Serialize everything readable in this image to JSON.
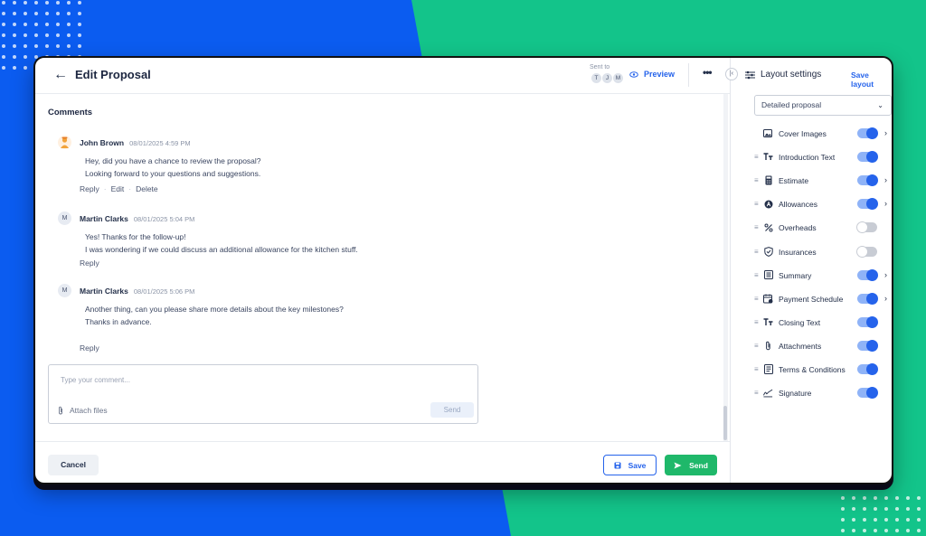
{
  "header": {
    "back_icon": "arrow-left-icon",
    "title": "Edit Proposal",
    "sent_to_label": "Sent to",
    "recipients": [
      "T",
      "J",
      "M"
    ],
    "preview_label": "Preview",
    "more_icon": "more-horizontal-icon"
  },
  "comments": {
    "heading": "Comments",
    "items": [
      {
        "author": "John Brown",
        "time": "08/01/2025 4:59 PM",
        "avatar": "",
        "lines": [
          "Hey, did you have a chance to review the proposal?",
          "Looking forward to your questions and suggestions."
        ],
        "actions": [
          "Reply",
          "Edit",
          "Delete"
        ]
      },
      {
        "author": "Martin Clarks",
        "time": "08/01/2025 5:04 PM",
        "avatar": "M",
        "lines": [
          "Yes! Thanks for the follow-up!",
          "I was wondering if we could discuss an additional allowance for the kitchen stuff."
        ],
        "actions": [
          "Reply"
        ]
      },
      {
        "author": "Martin Clarks",
        "time": "08/01/2025 5:06 PM",
        "avatar": "M",
        "lines": [
          "Another thing, can you please share more details about the key milestones?",
          "Thanks in advance."
        ],
        "actions": [
          "Reply"
        ]
      }
    ]
  },
  "composer": {
    "placeholder": "Type your comment...",
    "attach_label": "Attach files",
    "send_label": "Send"
  },
  "footer": {
    "cancel_label": "Cancel",
    "save_label": "Save",
    "send_label": "Send"
  },
  "panel": {
    "title": "Layout settings",
    "save_layout_label": "Save layout",
    "layout_select_value": "Detailed proposal",
    "sections": [
      {
        "label": "Cover Images",
        "icon": "image-icon",
        "enabled": true,
        "expandable": true,
        "draggable": false
      },
      {
        "label": "Introduction Text",
        "icon": "text-icon",
        "enabled": true,
        "expandable": false,
        "draggable": true
      },
      {
        "label": "Estimate",
        "icon": "calculator-icon",
        "enabled": true,
        "expandable": true,
        "draggable": true
      },
      {
        "label": "Allowances",
        "icon": "allowance-icon",
        "enabled": true,
        "expandable": true,
        "draggable": true
      },
      {
        "label": "Overheads",
        "icon": "percent-icon",
        "enabled": false,
        "expandable": false,
        "draggable": true
      },
      {
        "label": "Insurances",
        "icon": "shield-icon",
        "enabled": false,
        "expandable": false,
        "draggable": true
      },
      {
        "label": "Summary",
        "icon": "list-icon",
        "enabled": true,
        "expandable": true,
        "draggable": true
      },
      {
        "label": "Payment Schedule",
        "icon": "calendar-icon",
        "enabled": true,
        "expandable": true,
        "draggable": true
      },
      {
        "label": "Closing Text",
        "icon": "text-icon",
        "enabled": true,
        "expandable": false,
        "draggable": true
      },
      {
        "label": "Attachments",
        "icon": "paperclip-icon",
        "enabled": true,
        "expandable": false,
        "draggable": true
      },
      {
        "label": "Terms & Conditions",
        "icon": "document-icon",
        "enabled": true,
        "expandable": false,
        "draggable": true
      },
      {
        "label": "Signature",
        "icon": "signature-icon",
        "enabled": true,
        "expandable": false,
        "draggable": true
      }
    ]
  },
  "colors": {
    "background_blue": "#0b5cf0",
    "background_green": "#13c48a",
    "accent": "#2563eb",
    "send_green": "#1fb86a"
  }
}
